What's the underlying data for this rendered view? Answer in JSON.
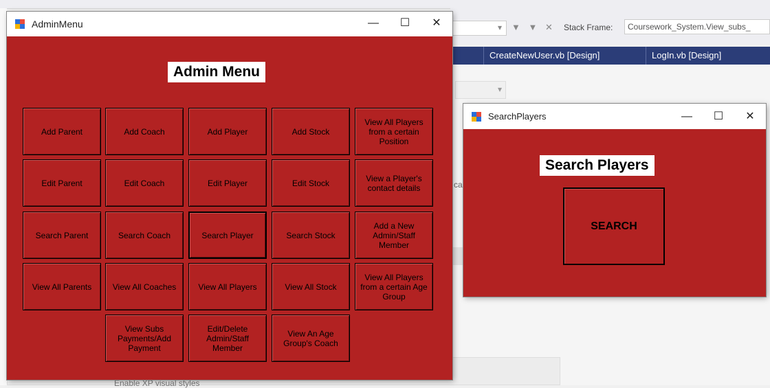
{
  "vs": {
    "stack_frame_label": "Stack Frame:",
    "stack_frame_value": "Coursework_System.View_subs_",
    "tabs": [
      "CreateNewUser.vb [Design]",
      "LogIn.vb [Design]"
    ],
    "fragment": "ca",
    "panel_text": "Enable XP visual styles"
  },
  "admin_window": {
    "title": "AdminMenu",
    "heading": "Admin Menu",
    "buttons": [
      [
        "Add Parent",
        "Add Coach",
        "Add Player",
        "Add Stock",
        "View All Players from a certain Position"
      ],
      [
        "Edit Parent",
        "Edit Coach",
        "Edit Player",
        "Edit Stock",
        "View a Player's contact details"
      ],
      [
        "Search Parent",
        "Search Coach",
        "Search Player",
        "Search Stock",
        "Add a New Admin/Staff Member"
      ],
      [
        "View All Parents",
        "View All Coaches",
        "View All Players",
        "View All Stock",
        "View All Players from a certain Age Group"
      ],
      [
        "",
        "View Subs Payments/Add Payment",
        "Edit/Delete Admin/Staff Member",
        "View An Age Group's Coach",
        ""
      ]
    ]
  },
  "search_window": {
    "title": "SearchPlayers",
    "heading": "Search Players",
    "button": "SEARCH"
  },
  "caption_buttons": {
    "minimize": "—",
    "maximize": "☐",
    "close": "✕"
  },
  "colors": {
    "form_red": "#b22222",
    "vs_tab_blue": "#2b3d78"
  }
}
